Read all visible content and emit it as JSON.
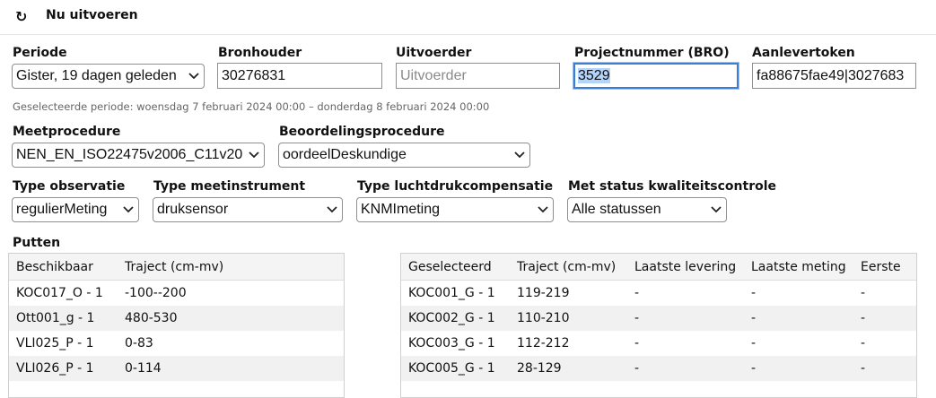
{
  "toolbar": {
    "refresh_label": "Nu uitvoeren"
  },
  "filters": {
    "periode": {
      "label": "Periode",
      "value": "Gister, 19 dagen geleden"
    },
    "bronhouder": {
      "label": "Bronhouder",
      "value": "30276831"
    },
    "uitvoerder": {
      "label": "Uitvoerder",
      "placeholder": "Uitvoerder"
    },
    "projectnummer": {
      "label": "Projectnummer (BRO)",
      "value": "3529"
    },
    "aanlevertoken": {
      "label": "Aanlevertoken",
      "value": "fa88675fae49|3027683"
    },
    "period_hint": "Geselecteerde periode: woensdag 7 februari 2024 00:00 – donderdag 8 februari 2024 00:00",
    "meetprocedure": {
      "label": "Meetprocedure",
      "value": "NEN_EN_ISO22475v2006_C11v20"
    },
    "beoordelingsprocedure": {
      "label": "Beoordelingsprocedure",
      "value": "oordeelDeskundige"
    },
    "type_observatie": {
      "label": "Type observatie",
      "value": "regulierMeting"
    },
    "type_meetinstrument": {
      "label": "Type meetinstrument",
      "value": "druksensor"
    },
    "type_luchtdruk": {
      "label": "Type luchtdrukcompensatie",
      "value": "KNMImeting"
    },
    "status_kwaliteit": {
      "label": "Met status kwaliteitscontrole",
      "value": "Alle statussen"
    }
  },
  "putten": {
    "title": "Putten",
    "available": {
      "headers": [
        "Beschikbaar",
        "Traject (cm-mv)"
      ],
      "rows": [
        [
          "KOC017_O - 1",
          "-100--200"
        ],
        [
          "Ott001_g - 1",
          "480-530"
        ],
        [
          "VLI025_P - 1",
          "0-83"
        ],
        [
          "VLI026_P - 1",
          "0-114"
        ]
      ]
    },
    "selected": {
      "headers": [
        "Geselecteerd",
        "Traject (cm-mv)",
        "Laatste levering",
        "Laatste meting",
        "Eerste"
      ],
      "rows": [
        [
          "KOC001_G - 1",
          "119-219",
          "-",
          "-",
          "-"
        ],
        [
          "KOC002_G - 1",
          "110-210",
          "-",
          "-",
          "-"
        ],
        [
          "KOC003_G - 1",
          "112-212",
          "-",
          "-",
          "-"
        ],
        [
          "KOC005_G - 1",
          "28-129",
          "-",
          "-",
          "-"
        ]
      ]
    }
  }
}
